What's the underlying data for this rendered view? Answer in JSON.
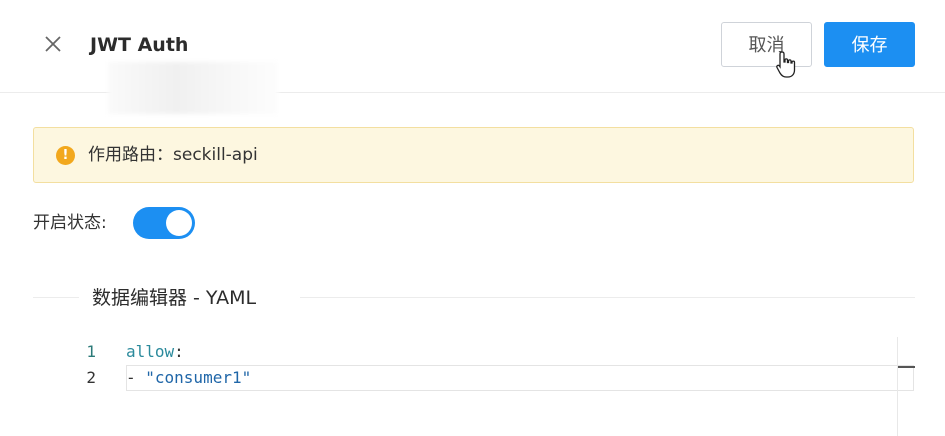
{
  "header": {
    "title": "JWT Auth",
    "cancel_label": "取消",
    "save_label": "保存"
  },
  "alert": {
    "icon": "exclamation-circle-icon",
    "text": "作用路由：seckill-api"
  },
  "status": {
    "label": "开启状态:",
    "enabled": true
  },
  "editor": {
    "title": "数据编辑器 - YAML",
    "lines": [
      {
        "number": "1",
        "key": "allow",
        "punct": ":"
      },
      {
        "number": "2",
        "dash": "- ",
        "value": "\"consumer1\""
      }
    ]
  },
  "colors": {
    "primary": "#1c8ff2",
    "warning": "#f2a81d",
    "alert_bg": "#fdf7e0"
  }
}
